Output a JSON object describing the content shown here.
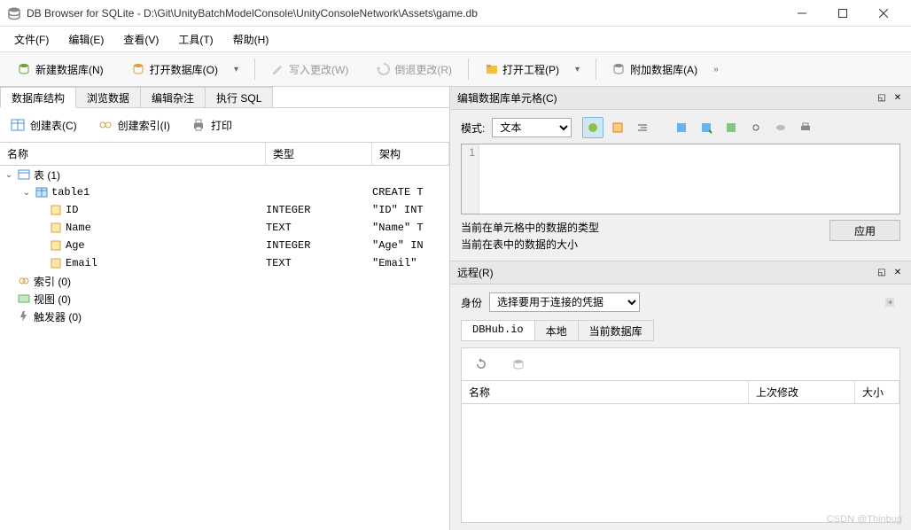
{
  "title": "DB Browser for SQLite - D:\\Git\\UnityBatchModelConsole\\UnityConsoleNetwork\\Assets\\game.db",
  "menu": {
    "file": "文件(F)",
    "edit": "编辑(E)",
    "view": "查看(V)",
    "tools": "工具(T)",
    "help": "帮助(H)"
  },
  "toolbar": {
    "new_db": "新建数据库(N)",
    "open_db": "打开数据库(O)",
    "write_changes": "写入更改(W)",
    "revert_changes": "倒退更改(R)",
    "open_project": "打开工程(P)",
    "attach_db": "附加数据库(A)"
  },
  "tabs": {
    "structure": "数据库结构",
    "browse": "浏览数据",
    "pragmas": "编辑杂注",
    "sql": "执行 SQL"
  },
  "subtoolbar": {
    "create_table": "创建表(C)",
    "create_index": "创建索引(I)",
    "print": "打印"
  },
  "tree": {
    "headers": {
      "name": "名称",
      "type": "类型",
      "schema": "架构"
    },
    "tables_label": "表 (1)",
    "indexes_label": "索引 (0)",
    "views_label": "视图 (0)",
    "triggers_label": "触发器 (0)",
    "table_name": "table1",
    "table_schema": "CREATE T",
    "columns": [
      {
        "name": "ID",
        "type": "INTEGER",
        "schema": "\"ID\" INT"
      },
      {
        "name": "Name",
        "type": "TEXT",
        "schema": "\"Name\" T"
      },
      {
        "name": "Age",
        "type": "INTEGER",
        "schema": "\"Age\" IN"
      },
      {
        "name": "Email",
        "type": "TEXT",
        "schema": "\"Email\""
      }
    ]
  },
  "cell_panel": {
    "title": "编辑数据库单元格(C)",
    "mode_label": "模式:",
    "mode_value": "文本",
    "line_number": "1",
    "info1": "当前在单元格中的数据的类型",
    "info2": "当前在表中的数据的大小",
    "apply": "应用"
  },
  "remote_panel": {
    "title": "远程(R)",
    "identity_label": "身份",
    "identity_value": "选择要用于连接的凭据",
    "tabs": {
      "dbhub": "DBHub.io",
      "local": "本地",
      "current": "当前数据库"
    },
    "headers": {
      "name": "名称",
      "modified": "上次修改",
      "size": "大小"
    }
  },
  "watermark": "CSDN @Thinbug"
}
